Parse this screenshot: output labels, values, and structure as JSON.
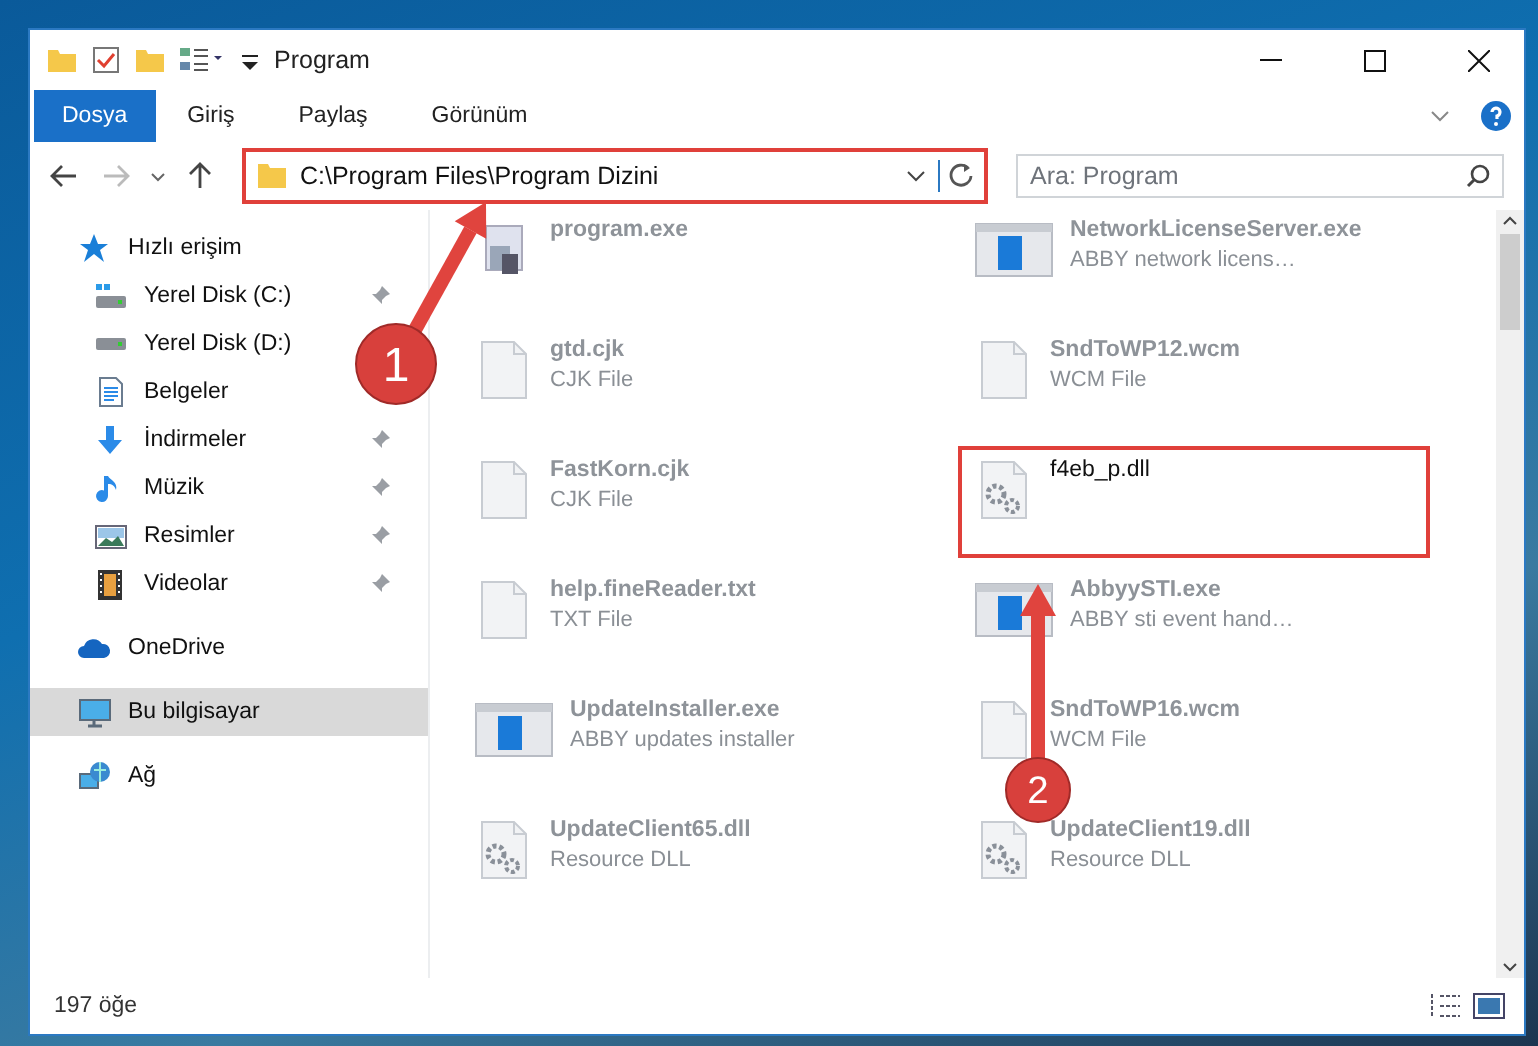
{
  "window": {
    "title": "Program"
  },
  "ribbon_tabs": [
    {
      "label": "Dosya",
      "selected": true
    },
    {
      "label": "Giriş",
      "selected": false
    },
    {
      "label": "Paylaş",
      "selected": false
    },
    {
      "label": "Görünüm",
      "selected": false
    }
  ],
  "address_bar": {
    "path": "C:\\Program Files\\Program Dizini",
    "highlighted": true
  },
  "search": {
    "placeholder": "Ara: Program"
  },
  "sidebar": {
    "items": [
      {
        "label": "Hızlı erişim",
        "kind": "star",
        "selected": false,
        "children": [
          {
            "label": "Yerel Disk (C:)",
            "kind": "windrive",
            "pinned": true,
            "selected": false
          },
          {
            "label": "Yerel Disk (D:)",
            "kind": "drive",
            "selected": false
          },
          {
            "label": "Belgeler",
            "kind": "docs",
            "selected": false
          },
          {
            "label": "İndirmeler",
            "kind": "download",
            "pinned": true,
            "selected": false
          },
          {
            "label": "Müzik",
            "kind": "music",
            "pinned": true,
            "selected": false
          },
          {
            "label": "Resimler",
            "kind": "pictures",
            "pinned": true,
            "selected": false
          },
          {
            "label": "Videolar",
            "kind": "video",
            "pinned": true,
            "selected": false
          }
        ]
      },
      {
        "label": "OneDrive",
        "kind": "cloud",
        "selected": false
      },
      {
        "label": "Bu bilgisayar",
        "kind": "pc",
        "selected": true
      },
      {
        "label": "Ağ",
        "kind": "network",
        "selected": false
      }
    ]
  },
  "files": [
    {
      "name": "program.exe",
      "kind": "setup",
      "highlighted": false
    },
    {
      "name": "NetworkLicenseServer.exe",
      "description": "ABBY network licens…",
      "kind": "app",
      "highlighted": false
    },
    {
      "name": "gtd.cjk",
      "description": "CJK File",
      "kind": "blank",
      "highlighted": false
    },
    {
      "name": "SndToWP12.wcm",
      "description": "WCM File",
      "kind": "blank",
      "highlighted": false
    },
    {
      "name": "FastKorn.cjk",
      "description": "CJK File",
      "kind": "blank",
      "highlighted": false
    },
    {
      "name": "f4eb_p.dll",
      "kind": "dll",
      "highlighted": true
    },
    {
      "name": "help.fineReader.txt",
      "description": "TXT File",
      "kind": "blank",
      "highlighted": false
    },
    {
      "name": "AbbyySTI.exe",
      "description": "ABBY sti event hand…",
      "kind": "app",
      "highlighted": false
    },
    {
      "name": "UpdateInstaller.exe",
      "description": "ABBY updates installer",
      "kind": "app",
      "highlighted": false
    },
    {
      "name": "SndToWP16.wcm",
      "description": "WCM File",
      "kind": "blank",
      "highlighted": false
    },
    {
      "name": "UpdateClient65.dll",
      "description": "Resource DLL",
      "kind": "dll",
      "highlighted": false
    },
    {
      "name": "UpdateClient19.dll",
      "description": "Resource DLL",
      "kind": "dll",
      "highlighted": false
    }
  ],
  "status_bar": {
    "item_count": "197 öğe"
  },
  "annotations": [
    {
      "label": "1"
    },
    {
      "label": "2"
    }
  ]
}
